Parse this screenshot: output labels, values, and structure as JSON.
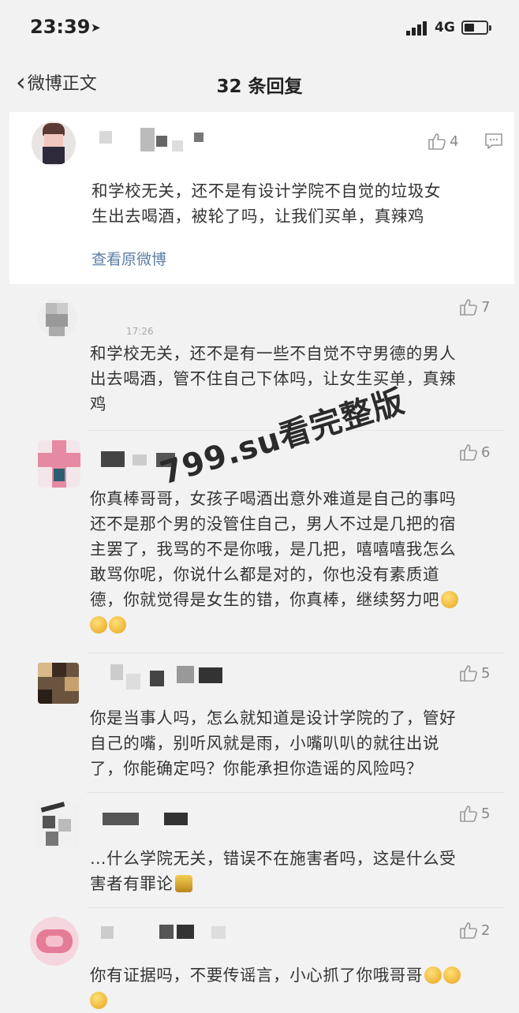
{
  "status_bar": {
    "time": "23:39",
    "network": "4G"
  },
  "nav": {
    "back_label": "微博正文",
    "title": "32 条回复"
  },
  "main_comment": {
    "likes": "4",
    "text_line1": "和学校无关，还不是有设计学院不自觉的垃圾女",
    "text_line2": "生出去喝酒，被轮了吗，让我们买单，真辣鸡",
    "view_original": "查看原微博"
  },
  "replies": [
    {
      "likes": "7",
      "timestamp": "17:26",
      "lines": [
        "和学校无关，还不是有一些不自觉不守男德的男人",
        "出去喝酒，管不住自己下体吗，让女生买单，真辣",
        "鸡"
      ]
    },
    {
      "likes": "6",
      "lines": [
        "你真棒哥哥，女孩子喝酒出意外难道是自己的事吗",
        "还不是那个男的没管住自己，男人不过是几把的宿",
        "主罢了，我骂的不是你哦，是几把，嘻嘻嘻我怎么",
        "敢骂你呢，你说什么都是对的，你也没有素质道",
        "德，你就觉得是女生的错，你真棒，继续努力吧"
      ]
    },
    {
      "likes": "5",
      "lines": [
        "你是当事人吗，怎么就知道是设计学院的了，管好",
        "自己的嘴，别听风就是雨，小嘴叭叭的就往出说",
        "了，你能确定吗？你能承担你造谣的风险吗？"
      ]
    },
    {
      "likes": "5",
      "lines": [
        "…什么学院无关，错误不在施害者吗，这是什么受",
        "害者有罪论"
      ]
    },
    {
      "likes": "2",
      "lines": [
        "你有证据吗，不要传谣言，小心抓了你哦哥哥"
      ]
    }
  ],
  "watermark": "799.su看完整版",
  "colors": {
    "link": "#5b7ea6",
    "background": "#f2f2f2",
    "card": "#ffffff"
  }
}
